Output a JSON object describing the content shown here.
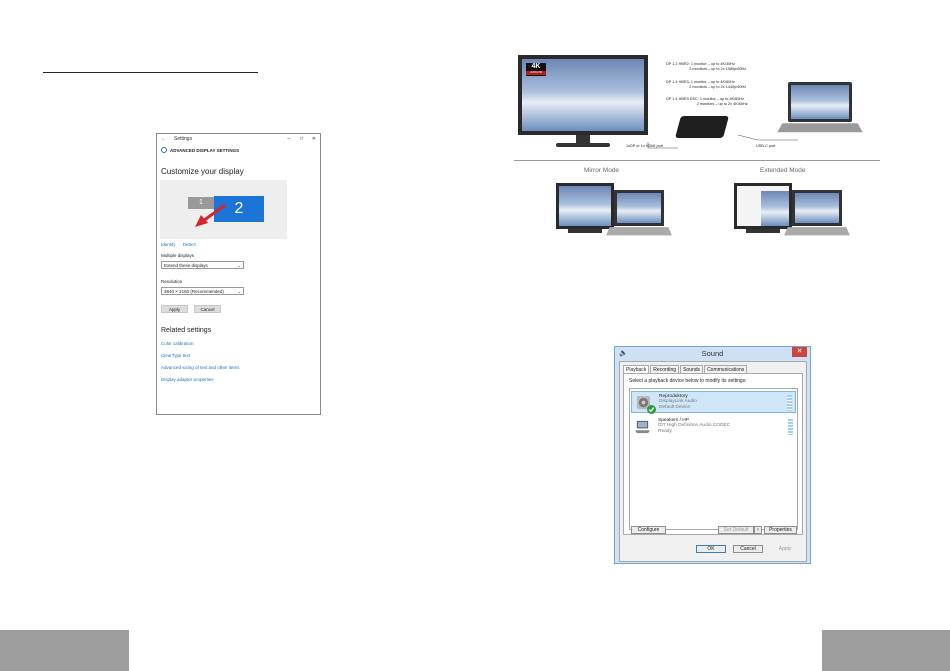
{
  "settings": {
    "window_title": "Settings",
    "header": "ADVANCED DISPLAY SETTINGS",
    "title": "Customize your display",
    "monitor1_label": "1",
    "monitor2_label": "2",
    "identify_link": "Identify",
    "detect_link": "Detect",
    "multiple_displays_label": "Multiple displays",
    "multiple_displays_value": "Extend these displays",
    "resolution_label": "Resolution",
    "resolution_value": "3840 × 2160 (Recommended)",
    "apply_label": "Apply",
    "cancel_label": "Cancel",
    "related_title": "Related settings",
    "related_links": [
      "Color calibration",
      "ClearType text",
      "Advanced sizing of text and other items",
      "Display adapter properties"
    ]
  },
  "dock_diagram": {
    "badge_4k": "4K",
    "badge_sub": "ULTRA HD",
    "spec_lines": [
      "DP 1.2 HBR2: 1 monitor – up to 4K/30Hz\n                      2 monitors – up to 2x 1080p/60Hz",
      "DP 1.4 HBR3: 1 monitor – up to 4K/60Hz\n                      2 monitors – up to 2x 1440p/60Hz",
      "DP 1.4 HBR3 DSC: 1 monitor – up to 5K/60Hz\n                             2 monitors – up to 2x 4K/60Hz"
    ],
    "port_left": "1xDP or 1x HDMI port",
    "port_right": "USB-C port",
    "mirror_label": "Mirror Mode",
    "extended_label": "Extended Mode"
  },
  "sound": {
    "title": "Sound",
    "close_glyph": "✕",
    "tabs": [
      "Playback",
      "Recording",
      "Sounds",
      "Communications"
    ],
    "hint": "Select a playback device below to modify its settings:",
    "devices": [
      {
        "name": "Reproduktory",
        "desc": "DisplayLink Audio",
        "status": "Default Device"
      },
      {
        "name": "Speakers / HP",
        "desc": "IDT High Definition Audio CODEC",
        "status": "Ready"
      }
    ],
    "configure_label": "Configure",
    "set_default_label": "Set Default",
    "properties_label": "Properties",
    "ok_label": "OK",
    "cancel_label": "Cancel",
    "apply_label": "Apply"
  }
}
